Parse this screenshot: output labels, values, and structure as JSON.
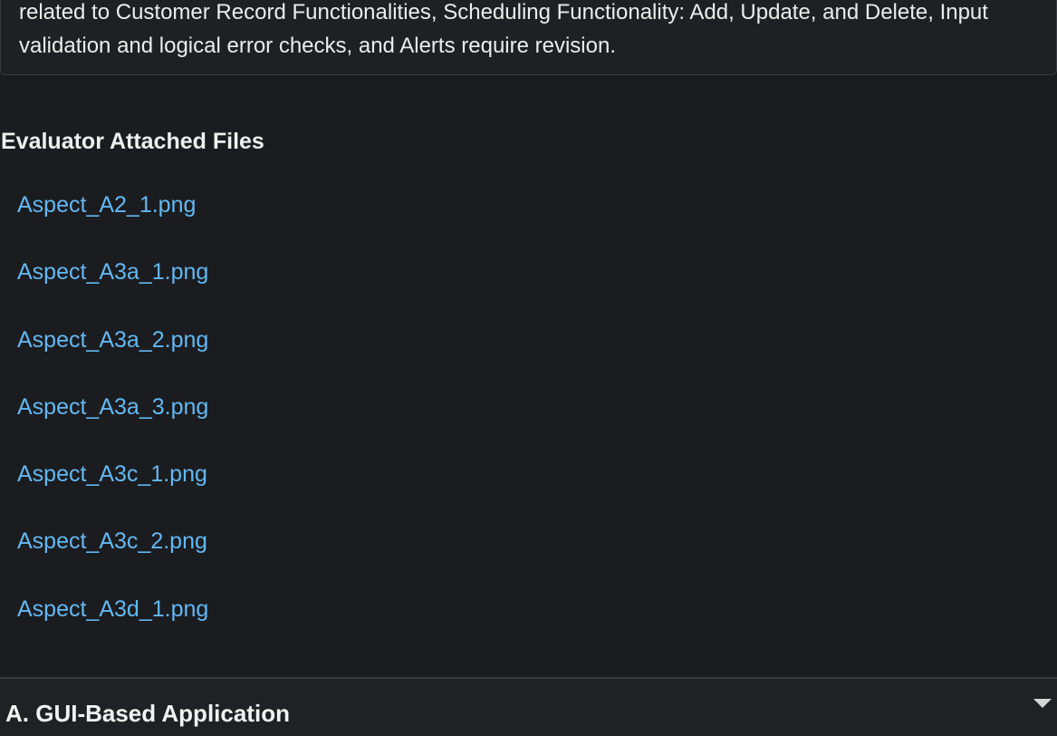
{
  "comment": {
    "text": "related to Customer Record Functionalities, Scheduling Functionality: Add, Update, and Delete, Input validation and logical error checks, and Alerts require revision."
  },
  "evaluator_files": {
    "title": "Evaluator Attached Files",
    "files": [
      "Aspect_A2_1.png",
      "Aspect_A3a_1.png",
      "Aspect_A3a_2.png",
      "Aspect_A3a_3.png",
      "Aspect_A3c_1.png",
      "Aspect_A3c_2.png",
      "Aspect_A3d_1.png"
    ],
    "link_color": "#62b8f3"
  },
  "section": {
    "title": "A. GUI-Based Application",
    "expand_icon": "chevron-down-icon"
  },
  "theme": {
    "background": "#1b1c1f"
  }
}
